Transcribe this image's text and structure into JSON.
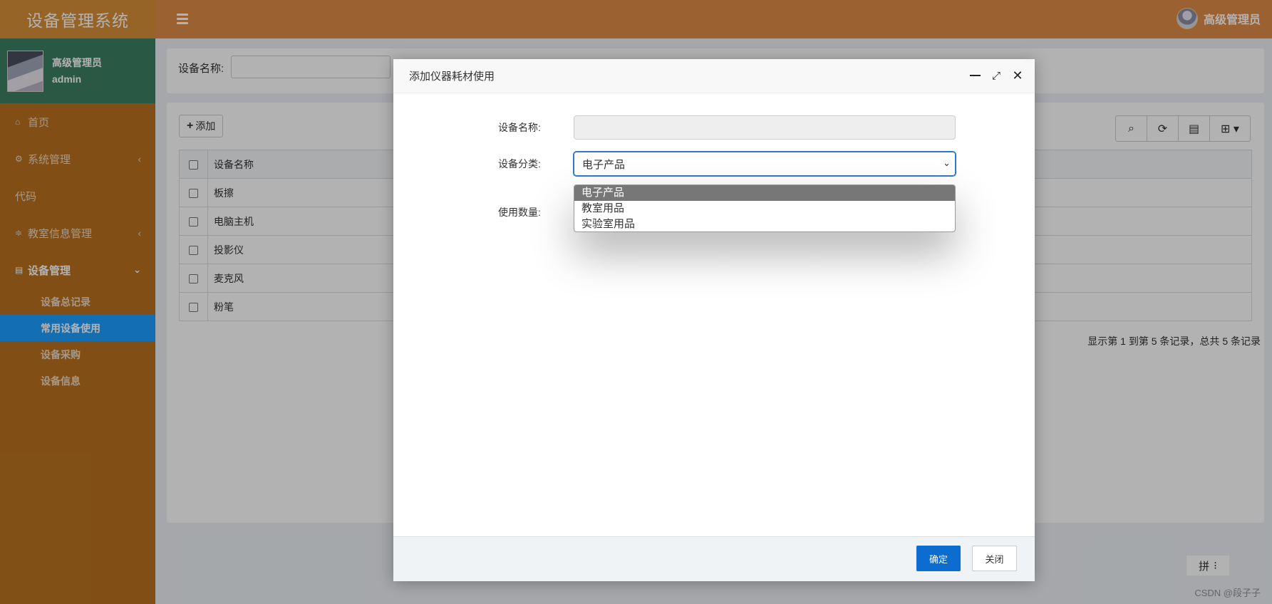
{
  "app": {
    "title": "设备管理系统"
  },
  "header": {
    "user_name": "高级管理员"
  },
  "sidebar": {
    "user": {
      "name": "高级管理员",
      "account": "admin"
    },
    "items": [
      {
        "icon": "home-icon",
        "label": "首页"
      },
      {
        "icon": "gear-icon",
        "label": "系统管理"
      },
      {
        "icon": "",
        "label": "代码"
      },
      {
        "icon": "sliders-icon",
        "label": "教室信息管理"
      },
      {
        "icon": "server-icon",
        "label": "设备管理"
      }
    ],
    "submenu": [
      {
        "label": "设备总记录"
      },
      {
        "label": "常用设备使用"
      },
      {
        "label": "设备采购"
      },
      {
        "label": "设备信息"
      }
    ]
  },
  "search": {
    "label": "设备名称:",
    "value": ""
  },
  "toolbar": {
    "add_label": "添加"
  },
  "table": {
    "header": "设备名称",
    "rows": [
      "板擦",
      "电脑主机",
      "投影仪",
      "麦克风",
      "粉笔"
    ],
    "pager_info": "显示第 1 到第 5 条记录，总共 5 条记录"
  },
  "modal": {
    "title": "添加仪器耗材使用",
    "fields": {
      "device_name_label": "设备名称:",
      "device_name_value": "",
      "category_label": "设备分类:",
      "category_value": "电子产品",
      "quantity_label": "使用数量:"
    },
    "category_options": [
      "电子产品",
      "教室用品",
      "实验室用品"
    ],
    "ok_label": "确定",
    "close_label": "关闭"
  },
  "corner": {
    "ime_label": "拼"
  },
  "watermark": "CSDN @段子子"
}
